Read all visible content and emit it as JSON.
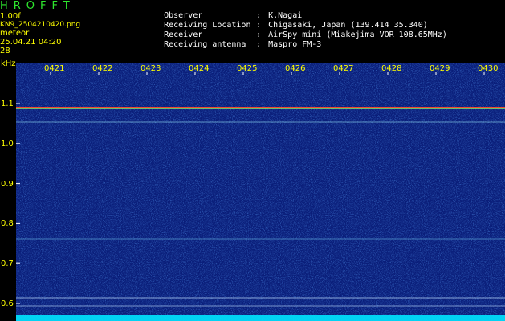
{
  "header": {
    "title": "HROFFT",
    "version": "1.00f",
    "filename": "KN9_2504210420.png",
    "meteor_label": "meteor",
    "meteor_count": "28",
    "datetime": "25.04.21 04:20"
  },
  "info": [
    {
      "label": "Observer",
      "value": "K.Nagai"
    },
    {
      "label": "Receiving Location",
      "value": "Chigasaki, Japan (139.414 35.340)"
    },
    {
      "label": "Receiver",
      "value": "AirSpy mini (Miakejima VOR 108.65MHz)"
    },
    {
      "label": "Receiving antenna",
      "value": "Maspro FM-3"
    }
  ],
  "axis": {
    "y_unit": "kHz",
    "y_ticks": [
      "1.1",
      "1.0",
      "0.9",
      "0.8",
      "0.7",
      "0.6"
    ],
    "x_ticks": [
      "0421",
      "0422",
      "0423",
      "0424",
      "0425",
      "0426",
      "0427",
      "0428",
      "0429",
      "0430"
    ]
  },
  "colors": {
    "background": "#000000",
    "spectrogram_bg": "#0a1e7a",
    "label_yellow": "#ffff00",
    "title_green": "#2ee82e",
    "strong_line": "#ff4a2a",
    "cyan_floor": "#00e5ff"
  }
}
